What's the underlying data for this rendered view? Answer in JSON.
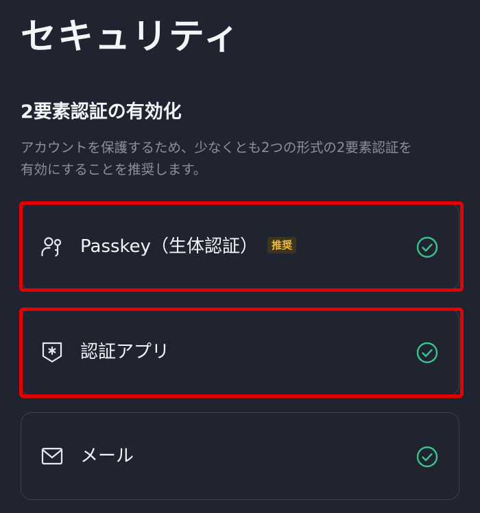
{
  "header": {
    "title": "セキュリティ"
  },
  "two_factor": {
    "title": "2要素認証の有効化",
    "description": "アカウントを保護するため、少なくとも2つの形式の2要素認証を\n有効にすることを推奨します。",
    "options": [
      {
        "label": "Passkey（生体認証）",
        "badge": "推奨",
        "icon": "passkey-user-key-icon",
        "status": "enabled"
      },
      {
        "label": "認証アプリ",
        "icon": "authenticator-shield-icon",
        "status": "enabled"
      },
      {
        "label": "メール",
        "icon": "mail-envelope-icon",
        "status": "enabled"
      }
    ]
  },
  "colors": {
    "background": "#1f2430",
    "card_border": "#3a404d",
    "check_green": "#3cc28a",
    "badge_text": "#f2b73a",
    "badge_bg": "#3b3520",
    "highlight_red": "#e60000"
  }
}
